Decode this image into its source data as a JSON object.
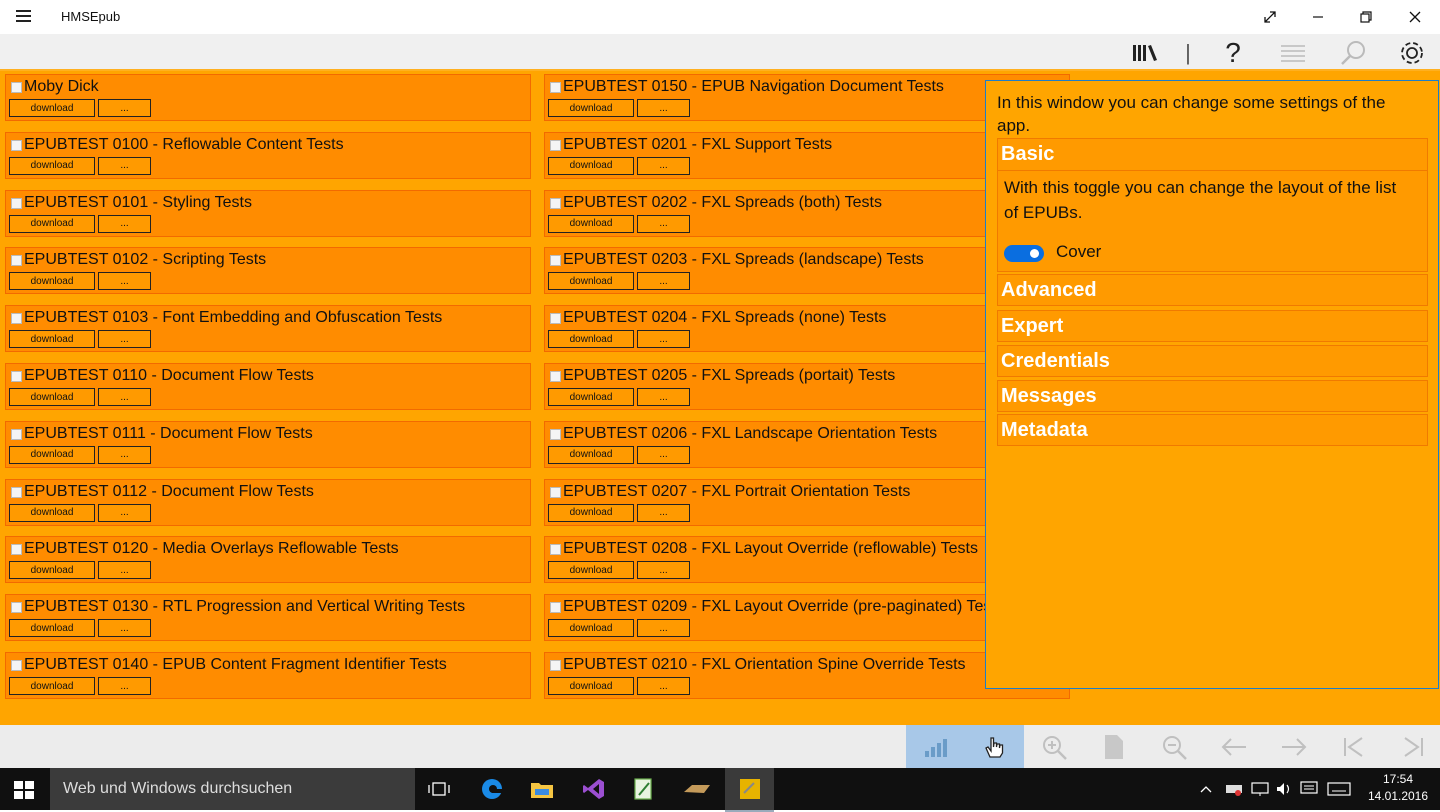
{
  "window": {
    "title": "HMSEpub",
    "menu_icon": "hamburger-icon",
    "buttons": [
      "fullscreen-icon",
      "minimize-icon",
      "restore-icon",
      "close-icon"
    ]
  },
  "toolbar": {
    "icons": [
      "library-icon",
      "help-icon",
      "text-list-icon",
      "search-icon",
      "settings-icon"
    ],
    "separator": "|",
    "help_glyph": "?"
  },
  "books": {
    "download_label": "download",
    "more_label": "...",
    "left": [
      "Moby Dick",
      "EPUBTEST 0100 - Reflowable Content Tests",
      "EPUBTEST 0101 - Styling Tests",
      "EPUBTEST 0102 - Scripting Tests",
      "EPUBTEST 0103 - Font Embedding and Obfuscation Tests",
      "EPUBTEST 0110 - Document Flow Tests",
      "EPUBTEST 0111 - Document Flow Tests",
      "EPUBTEST 0112 - Document Flow Tests",
      "EPUBTEST 0120 - Media Overlays Reflowable Tests",
      "EPUBTEST 0130 - RTL Progression and Vertical Writing Tests",
      "EPUBTEST 0140 - EPUB Content Fragment Identifier Tests"
    ],
    "right": [
      "EPUBTEST 0150 - EPUB Navigation Document Tests",
      "EPUBTEST 0201 - FXL Support Tests",
      "EPUBTEST 0202 - FXL Spreads (both) Tests",
      "EPUBTEST 0203 - FXL Spreads (landscape) Tests",
      "EPUBTEST 0204 - FXL Spreads (none) Tests",
      "EPUBTEST 0205 - FXL Spreads (portait) Tests",
      "EPUBTEST 0206 - FXL Landscape Orientation Tests",
      "EPUBTEST 0207 - FXL Portrait Orientation Tests",
      "EPUBTEST 0208 - FXL Layout Override (reflowable) Tests",
      "EPUBTEST 0209 - FXL Layout Override (pre-paginated) Tes",
      "EPUBTEST 0210 - FXL Orientation Spine Override Tests"
    ]
  },
  "settings": {
    "intro": "In this window you can change some settings of the app.",
    "basic": {
      "header": "Basic",
      "description": "With this toggle you can change the layout of the list of EPUBs.",
      "toggle_label": "Cover",
      "toggle_on": true
    },
    "sections": [
      "Advanced",
      "Expert",
      "Credentials",
      "Messages",
      "Metadata"
    ]
  },
  "appbar": {
    "icons": [
      "signal-bars-icon",
      "touch-hand-icon",
      "zoom-in-icon",
      "page-icon",
      "zoom-out-icon",
      "arrow-left-icon",
      "arrow-right-icon",
      "first-page-icon",
      "last-page-icon"
    ]
  },
  "taskbar": {
    "search_placeholder": "Web und Windows durchsuchen",
    "apps": [
      "task-view-icon",
      "edge-icon",
      "file-explorer-icon",
      "visual-studio-icon",
      "notepad-icon",
      "app-icon",
      "hmsepub-icon"
    ],
    "time": "17:54",
    "date": "14.01.2016"
  },
  "colors": {
    "content_bg": "#ffa500",
    "item_bg": "#ff8c00",
    "accent_blue": "#0a6ee0",
    "highlight_btn": "#a8c8e8"
  }
}
